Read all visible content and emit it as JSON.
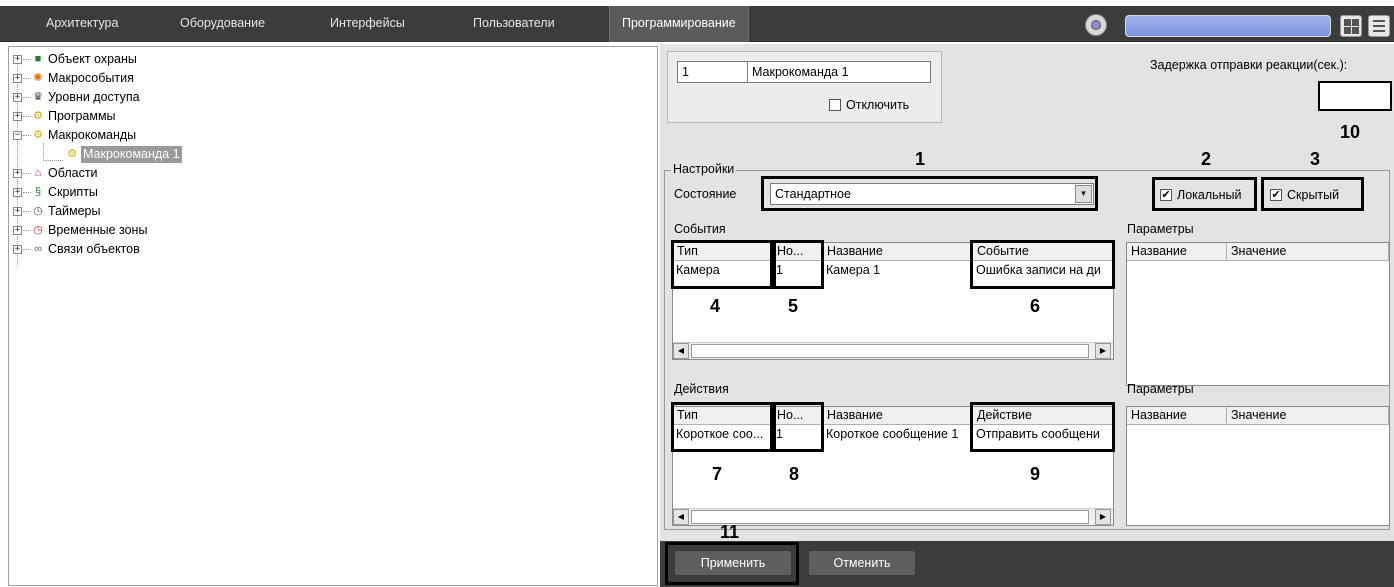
{
  "menu": {
    "tabs": [
      {
        "label": "Архитектура"
      },
      {
        "label": "Оборудование"
      },
      {
        "label": "Интерфейсы"
      },
      {
        "label": "Пользователи"
      },
      {
        "label": "Программирование",
        "active": true
      }
    ]
  },
  "tree": {
    "items": [
      {
        "label": "Объект охраны",
        "icon": "security-object-icon",
        "expander": "+"
      },
      {
        "label": "Макрособытия",
        "icon": "macro-event-icon",
        "expander": "+"
      },
      {
        "label": "Уровни доступа",
        "icon": "access-level-icon",
        "expander": "+"
      },
      {
        "label": "Программы",
        "icon": "programs-icon",
        "expander": "+"
      },
      {
        "label": "Макрокоманды",
        "icon": "macro-command-icon",
        "expander": "−"
      },
      {
        "label": "Макрокоманда 1",
        "icon": "macro-command-icon",
        "selected": true
      },
      {
        "label": "Области",
        "icon": "areas-icon",
        "expander": "+"
      },
      {
        "label": "Скрипты",
        "icon": "scripts-icon",
        "expander": "+"
      },
      {
        "label": "Таймеры",
        "icon": "timers-icon",
        "expander": "+"
      },
      {
        "label": "Временные зоны",
        "icon": "time-zones-icon",
        "expander": "+"
      },
      {
        "label": "Связи объектов",
        "icon": "object-links-icon",
        "expander": "+"
      }
    ]
  },
  "macro": {
    "id": "1",
    "name": "Макрокоманда 1",
    "disable_label": "Отключить",
    "disable_checked": false,
    "delay_label": "Задержка отправки реакции(сек.):",
    "delay_value": ""
  },
  "settings": {
    "legend": "Настройки",
    "state_label": "Состояние",
    "state_value": "Стандартное",
    "local_label": "Локальный",
    "local_checked": true,
    "hidden_label": "Скрытый",
    "hidden_checked": true
  },
  "events": {
    "title": "События",
    "columns": [
      "Тип",
      "Но...",
      "Название",
      "Событие"
    ],
    "rows": [
      [
        "Камера",
        "1",
        "Камера 1",
        "Ошибка записи на ди"
      ]
    ]
  },
  "event_params": {
    "title": "Параметры",
    "columns": [
      "Название",
      "Значение"
    ]
  },
  "actions": {
    "title": "Действия",
    "columns": [
      "Тип",
      "Но...",
      "Название",
      "Действие"
    ],
    "rows": [
      [
        "Короткое соо...",
        "1",
        "Короткое сообщение 1",
        "Отправить сообщени"
      ]
    ]
  },
  "action_params": {
    "title": "Параметры",
    "columns": [
      "Название",
      "Значение"
    ]
  },
  "callouts": {
    "n1": "1",
    "n2": "2",
    "n3": "3",
    "n4": "4",
    "n5": "5",
    "n6": "6",
    "n7": "7",
    "n8": "8",
    "n9": "9",
    "n10": "10",
    "n11": "11"
  },
  "buttons": {
    "apply": "Применить",
    "cancel": "Отменить"
  }
}
